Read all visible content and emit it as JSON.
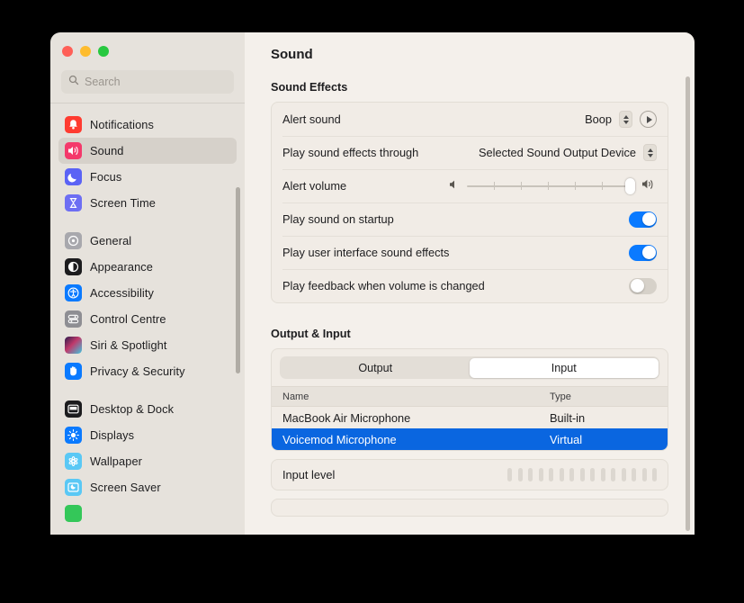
{
  "window": {
    "traffic_lights": [
      {
        "name": "close",
        "color": "#ff5f57"
      },
      {
        "name": "minimize",
        "color": "#febc2e"
      },
      {
        "name": "maximize",
        "color": "#28c840"
      }
    ]
  },
  "search": {
    "placeholder": "Search",
    "value": ""
  },
  "sidebar": {
    "groups": [
      {
        "items": [
          {
            "label": "Notifications",
            "icon": "notifications-icon",
            "selected": false
          },
          {
            "label": "Sound",
            "icon": "sound-icon",
            "selected": true
          },
          {
            "label": "Focus",
            "icon": "focus-icon",
            "selected": false
          },
          {
            "label": "Screen Time",
            "icon": "screen-time-icon",
            "selected": false
          }
        ]
      },
      {
        "items": [
          {
            "label": "General",
            "icon": "general-icon",
            "selected": false
          },
          {
            "label": "Appearance",
            "icon": "appearance-icon",
            "selected": false
          },
          {
            "label": "Accessibility",
            "icon": "accessibility-icon",
            "selected": false
          },
          {
            "label": "Control Centre",
            "icon": "control-centre-icon",
            "selected": false
          },
          {
            "label": "Siri & Spotlight",
            "icon": "siri-icon",
            "selected": false
          },
          {
            "label": "Privacy & Security",
            "icon": "privacy-icon",
            "selected": false
          }
        ]
      },
      {
        "items": [
          {
            "label": "Desktop & Dock",
            "icon": "desktop-dock-icon",
            "selected": false
          },
          {
            "label": "Displays",
            "icon": "displays-icon",
            "selected": false
          },
          {
            "label": "Wallpaper",
            "icon": "wallpaper-icon",
            "selected": false
          },
          {
            "label": "Screen Saver",
            "icon": "screen-saver-icon",
            "selected": false
          }
        ]
      }
    ]
  },
  "main": {
    "title": "Sound",
    "sound_effects": {
      "heading": "Sound Effects",
      "alert_sound": {
        "label": "Alert sound",
        "value": "Boop"
      },
      "play_through": {
        "label": "Play sound effects through",
        "value": "Selected Sound Output Device"
      },
      "alert_volume": {
        "label": "Alert volume",
        "value": 100,
        "min": 0,
        "max": 100,
        "ticks": 5
      },
      "startup_sound": {
        "label": "Play sound on startup",
        "value": "on"
      },
      "ui_sound_effects": {
        "label": "Play user interface sound effects",
        "value": "on"
      },
      "volume_feedback": {
        "label": "Play feedback when volume is changed",
        "value": "off"
      }
    },
    "output_input": {
      "heading": "Output & Input",
      "tabs": [
        {
          "label": "Output",
          "active": false
        },
        {
          "label": "Input",
          "active": true
        }
      ],
      "columns": [
        "Name",
        "Type"
      ],
      "rows": [
        {
          "name": "MacBook Air Microphone",
          "type": "Built-in",
          "selected": false
        },
        {
          "name": "Voicemod Microphone",
          "type": "Virtual",
          "selected": true
        }
      ],
      "input_level": {
        "label": "Input level",
        "segments": 15,
        "active_segments": 0
      }
    }
  },
  "colors": {
    "accent_blue": "#0a7aff",
    "selection_blue": "#0a66e0",
    "sidebar_bg": "#e6e2dc",
    "main_bg": "#f4f0eb",
    "card_bg": "#f1ece6"
  }
}
